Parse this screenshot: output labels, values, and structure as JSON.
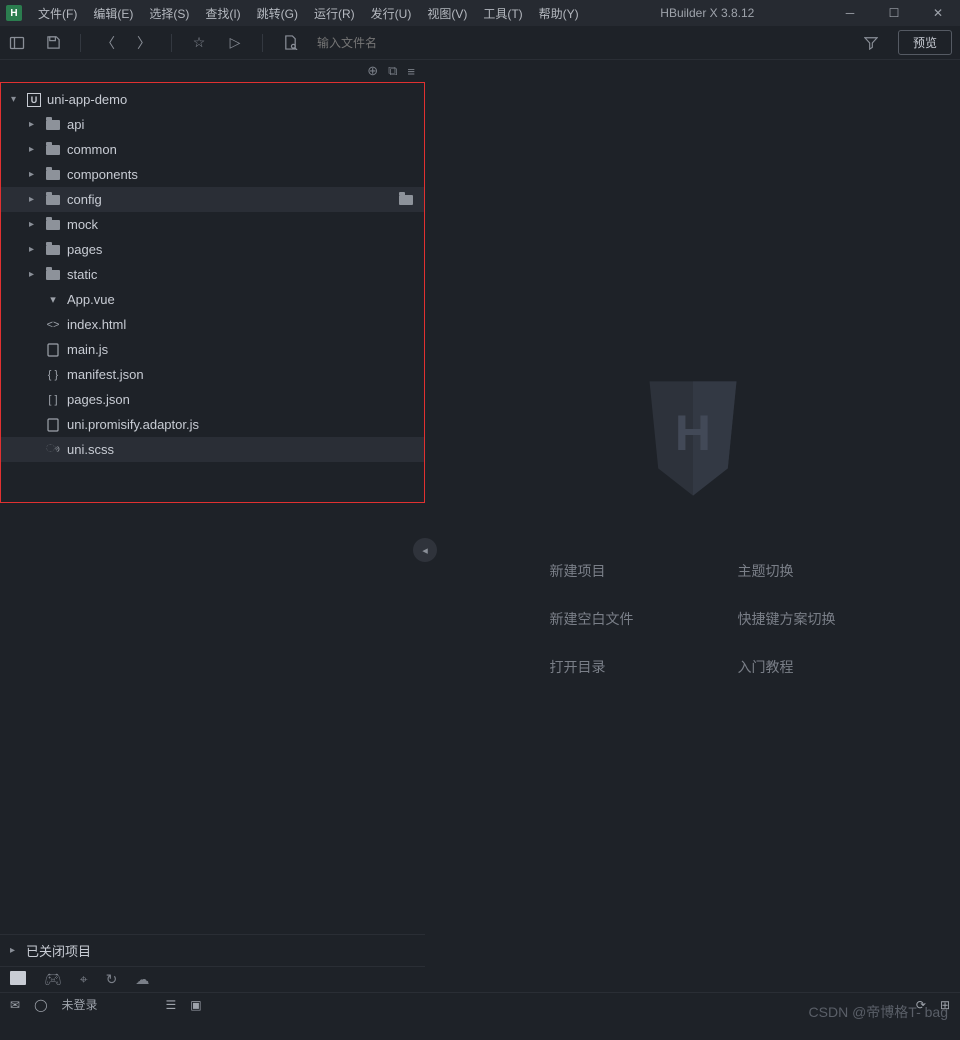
{
  "titlebar": {
    "app_letter": "H",
    "title": "HBuilder X 3.8.12"
  },
  "menu": {
    "file": "文件(F)",
    "edit": "编辑(E)",
    "select": "选择(S)",
    "find": "查找(I)",
    "goto": "跳转(G)",
    "run": "运行(R)",
    "publish": "发行(U)",
    "view": "视图(V)",
    "tools": "工具(T)",
    "help": "帮助(Y)"
  },
  "toolbar": {
    "search_placeholder": "输入文件名",
    "preview_label": "预览"
  },
  "explorer": {
    "project_name": "uni-app-demo",
    "closed_projects_label": "已关闭项目",
    "items": [
      {
        "name": "api",
        "type": "folder"
      },
      {
        "name": "common",
        "type": "folder"
      },
      {
        "name": "components",
        "type": "folder"
      },
      {
        "name": "config",
        "type": "folder",
        "highlight": true,
        "right_icon": true
      },
      {
        "name": "mock",
        "type": "folder"
      },
      {
        "name": "pages",
        "type": "folder"
      },
      {
        "name": "static",
        "type": "folder"
      },
      {
        "name": "App.vue",
        "type": "vue"
      },
      {
        "name": "index.html",
        "type": "html"
      },
      {
        "name": "main.js",
        "type": "js"
      },
      {
        "name": "manifest.json",
        "type": "json"
      },
      {
        "name": "pages.json",
        "type": "json2"
      },
      {
        "name": "uni.promisify.adaptor.js",
        "type": "js"
      },
      {
        "name": "uni.scss",
        "type": "scss",
        "highlight": true
      }
    ]
  },
  "welcome": {
    "shield_letter": "H",
    "links": {
      "new_project": "新建项目",
      "theme_switch": "主题切换",
      "new_file": "新建空白文件",
      "shortcut_switch": "快捷键方案切换",
      "open_dir": "打开目录",
      "tutorial": "入门教程"
    }
  },
  "statusbar": {
    "login": "未登录"
  },
  "watermark": "CSDN @帝博格T- bag"
}
